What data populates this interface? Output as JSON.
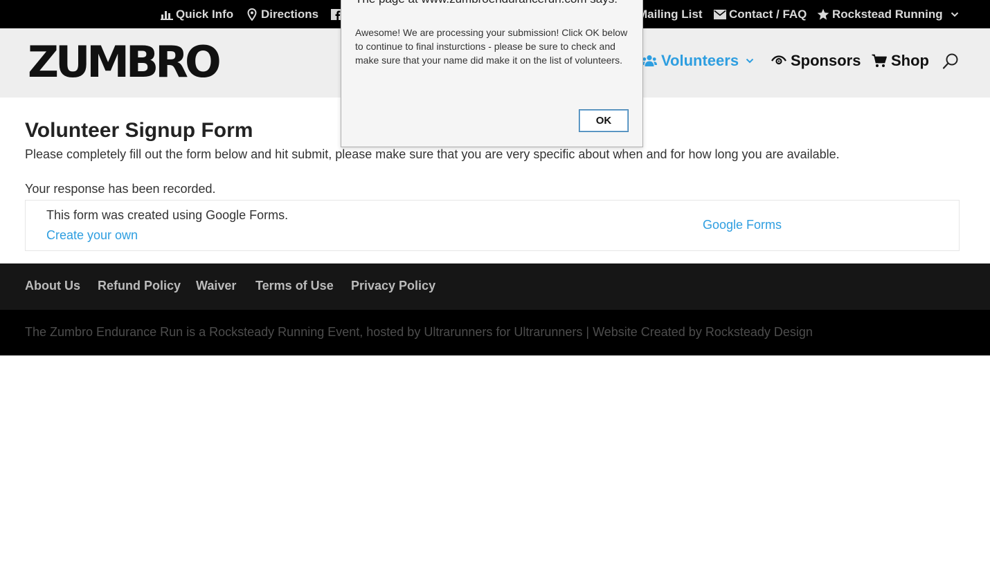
{
  "top_bar": {
    "items": [
      {
        "label": "Quick Info",
        "icon": "bar-chart-icon"
      },
      {
        "label": "Directions",
        "icon": "map-pin-icon"
      },
      {
        "label": "Mailing List",
        "icon": "mail-list-icon"
      },
      {
        "label": "Contact / FAQ",
        "icon": "envelope-icon"
      },
      {
        "label": "Rockstead Running",
        "icon": "star-icon"
      }
    ]
  },
  "header": {
    "logo_text": "ZUMBRO",
    "nav": [
      {
        "label": "Volunteers",
        "icon": "users-icon",
        "active": true
      },
      {
        "label": "Sponsors",
        "icon": "eye-icon",
        "active": false
      },
      {
        "label": "Shop",
        "icon": "cart-icon",
        "active": false
      }
    ]
  },
  "main": {
    "title": "Volunteer Signup Form",
    "description": "Please completely fill out the form below and hit submit, please make sure that you are very specific about when and for how long you are available.",
    "response": "Your response has been recorded.",
    "gform": {
      "created_text": "This form was created using Google Forms.",
      "create_link": "Create your own",
      "brand_link": "Google Forms"
    }
  },
  "footer": {
    "links": [
      "About Us",
      "Refund Policy",
      "Waiver",
      "Terms of Use",
      "Privacy Policy"
    ],
    "copyright": "The Zumbro Endurance Run is a Rocksteady Running Event, hosted by Ultrarunners for Ultrarunners | Website Created by Rocksteady Design"
  },
  "dialog": {
    "title": "The page at www.zumbroendurancerun.com says:",
    "message": "Awesome!  We are processing your submission!  Click OK below to continue to final insturctions - please be sure to check and make sure that your name did make it on the list of volunteers.",
    "ok_label": "OK"
  },
  "colors": {
    "accent": "#2e9ee0",
    "top_bar_bg": "#000000",
    "header_bg": "#eeeeee",
    "footer_bg": "#161616"
  }
}
